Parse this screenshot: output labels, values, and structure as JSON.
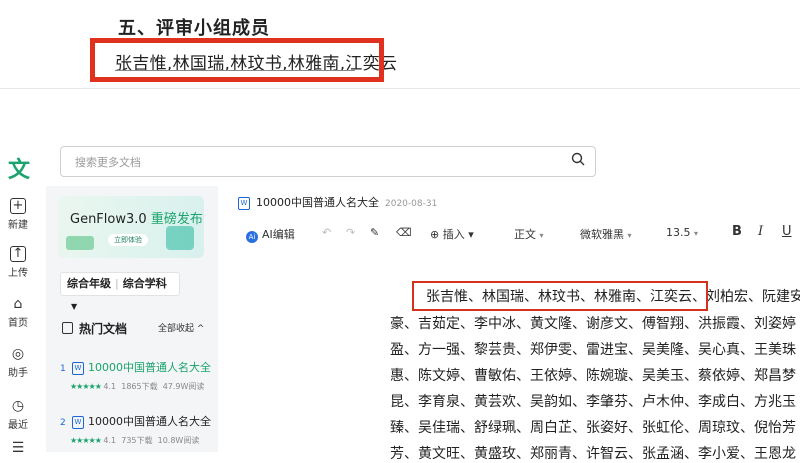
{
  "top_doc": {
    "section_title": "五、评审小组成员",
    "members": "张吉惟,林国瑞,林玟书,林雅南,江奕云"
  },
  "leftnav": {
    "logo": "文",
    "items": [
      {
        "label": "新建",
        "icon": "plus-icon"
      },
      {
        "label": "上传",
        "icon": "upload-icon"
      },
      {
        "label": "首页",
        "icon": "home-icon"
      },
      {
        "label": "助手",
        "icon": "assistant-icon"
      },
      {
        "label": "最近",
        "icon": "clock-icon"
      }
    ]
  },
  "search": {
    "placeholder": "搜索更多文档"
  },
  "banner": {
    "title": "GenFlow3.0",
    "highlight": "重磅发布",
    "button": "立即体验"
  },
  "filter": {
    "grade": "综合年级",
    "subject": "综合学科",
    "arrow": "▼"
  },
  "hot_docs": {
    "title": "热门文档",
    "collapse": "全部收起 ^",
    "items": [
      {
        "index": "1",
        "name": "10000中国普通人名大全",
        "rating": "4.1",
        "downloads": "1865下载",
        "reads": "47.9W阅读",
        "stars": "★★★★★"
      },
      {
        "index": "2",
        "name": "10000中国普通人名大全",
        "rating": "4.1",
        "downloads": "735下载",
        "reads": "10.8W阅读",
        "stars": "★★★★★"
      }
    ]
  },
  "doc": {
    "title": "10000中国普通人名大全",
    "date": "2020-08-31"
  },
  "toolbar": {
    "ai_edit": "AI编辑",
    "undo": "↶",
    "redo": "↷",
    "format_painter": "✎",
    "eraser": "⌫",
    "insert": "⊕ 插入 ▾",
    "style": "正文",
    "font": "微软雅黑",
    "size": "13.5",
    "bold": "B",
    "italic": "I",
    "underline": "U",
    "caret": "▾"
  },
  "doc_lines": [
    "张吉惟、林国瑞、林玟书、林雅南、江奕云、刘柏宏、阮建安",
    "豪、吉茹定、李中冰、黄文隆、谢彦文、傅智翔、洪振霞、刘姿婷",
    "盈、方一强、黎芸贵、郑伊雯、雷进宝、吴美隆、吴心真、王美珠",
    "惠、陈文婷、曹敏佑、王依婷、陈婉璇、吴美玉、蔡依婷、郑昌梦",
    "昆、李育泉、黄芸欢、吴韵如、李肇芬、卢木仲、李成白、方兆玉",
    "臻、吴佳瑞、舒绿珮、周白芷、张姿好、张虹伦、周琼玟、倪怡芳",
    "芳、黄文旺、黄盛玫、郑丽青、许智云、张孟涵、李小爱、王恩龙"
  ]
}
